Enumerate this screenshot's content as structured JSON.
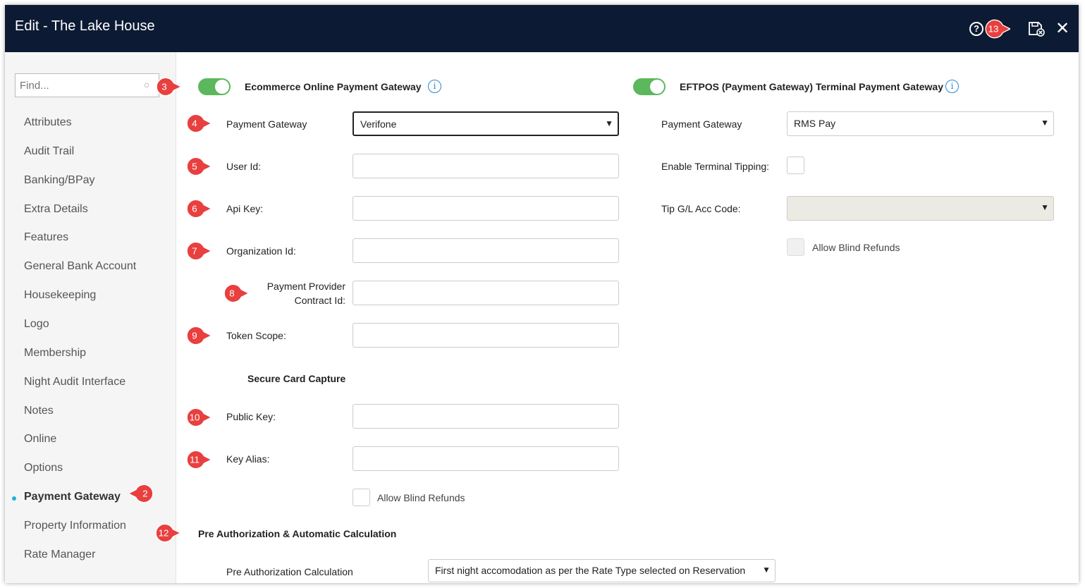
{
  "window": {
    "title": "Edit - The Lake House"
  },
  "titlebar": {
    "help_icon": "question-circle-icon",
    "save_icon": "save-close-icon",
    "close_icon": "close-icon"
  },
  "sidebar": {
    "search_placeholder": "Find...",
    "items": [
      {
        "label": "Attributes"
      },
      {
        "label": "Audit Trail"
      },
      {
        "label": "Banking/BPay"
      },
      {
        "label": "Extra Details"
      },
      {
        "label": "Features"
      },
      {
        "label": "General Bank Account"
      },
      {
        "label": "Housekeeping"
      },
      {
        "label": "Logo"
      },
      {
        "label": "Membership"
      },
      {
        "label": "Night Audit Interface"
      },
      {
        "label": "Notes"
      },
      {
        "label": "Online"
      },
      {
        "label": "Options"
      },
      {
        "label": "Payment Gateway",
        "active": true
      },
      {
        "label": "Property Information"
      },
      {
        "label": "Rate Manager"
      }
    ]
  },
  "ecommerce": {
    "heading": "Ecommerce Online Payment Gateway",
    "enabled": true,
    "payment_gateway_label": "Payment Gateway",
    "payment_gateway_value": "Verifone",
    "user_id_label": "User Id:",
    "api_key_label": "Api Key:",
    "organization_id_label": "Organization Id:",
    "provider_contract_label_1": "Payment Provider",
    "provider_contract_label_2": "Contract Id:",
    "token_scope_label": "Token Scope:",
    "secure_card_heading": "Secure Card Capture",
    "public_key_label": "Public Key:",
    "key_alias_label": "Key Alias:",
    "allow_blind_refunds_label": "Allow Blind Refunds"
  },
  "eftpos": {
    "heading": "EFTPOS (Payment Gateway) Terminal Payment Gateway",
    "enabled": true,
    "payment_gateway_label": "Payment Gateway",
    "payment_gateway_value": "RMS Pay",
    "terminal_tipping_label": "Enable Terminal Tipping:",
    "tip_acc_label": "Tip G/L Acc Code:",
    "allow_blind_refunds_label": "Allow Blind Refunds"
  },
  "preauth": {
    "heading": "Pre Authorization & Automatic Calculation",
    "calc_label": "Pre Authorization Calculation",
    "calc_value": "First night accomodation as per the Rate Type selected on Reservation"
  },
  "markers": [
    "2",
    "3",
    "4",
    "5",
    "6",
    "7",
    "8",
    "9",
    "10",
    "11",
    "12",
    "13"
  ],
  "colors": {
    "titlebar": "#0c1b33",
    "toggle_on": "#5cb85c",
    "marker": "#e8403f",
    "active_dot": "#1fb0d8"
  }
}
